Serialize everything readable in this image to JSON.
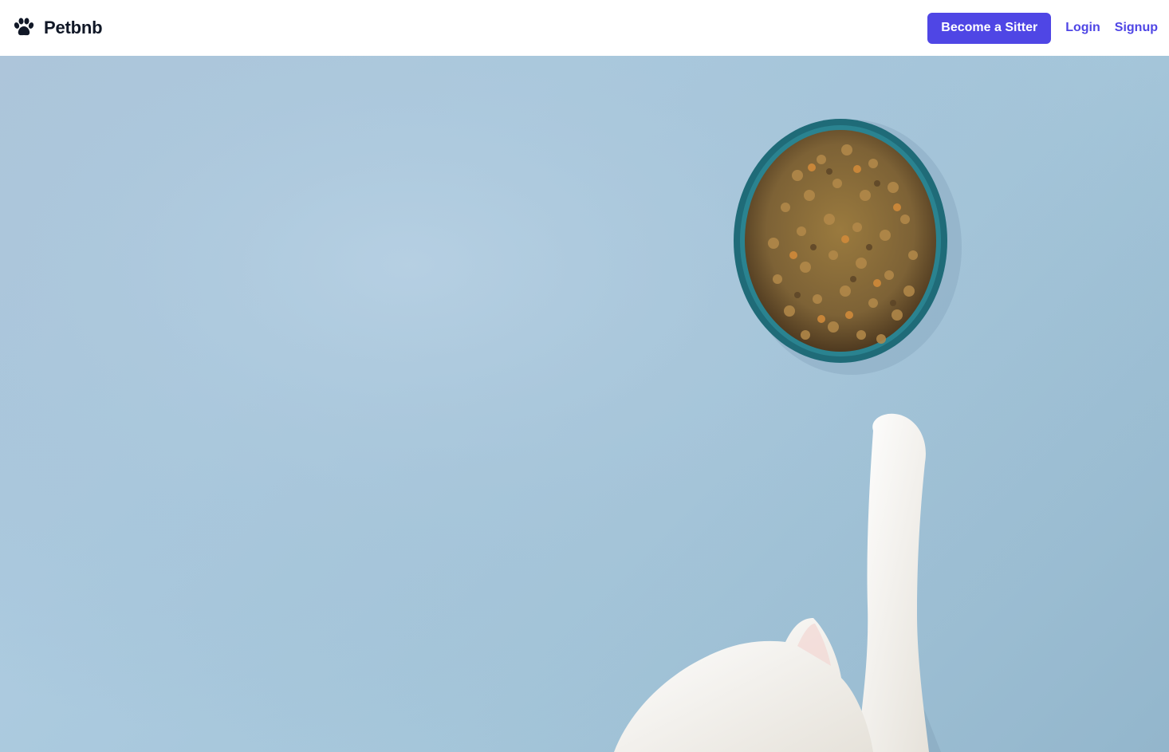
{
  "brand": {
    "name": "Petbnb",
    "icon": "paw-icon"
  },
  "nav": {
    "become_sitter_label": "Become a Sitter",
    "login_label": "Login",
    "signup_label": "Signup"
  },
  "colors": {
    "accent": "#4f46e5",
    "hero_background": "#adcbe0",
    "bowl": "#1e6a78"
  },
  "hero": {
    "image": "cat-reaching-for-food-bowl"
  }
}
